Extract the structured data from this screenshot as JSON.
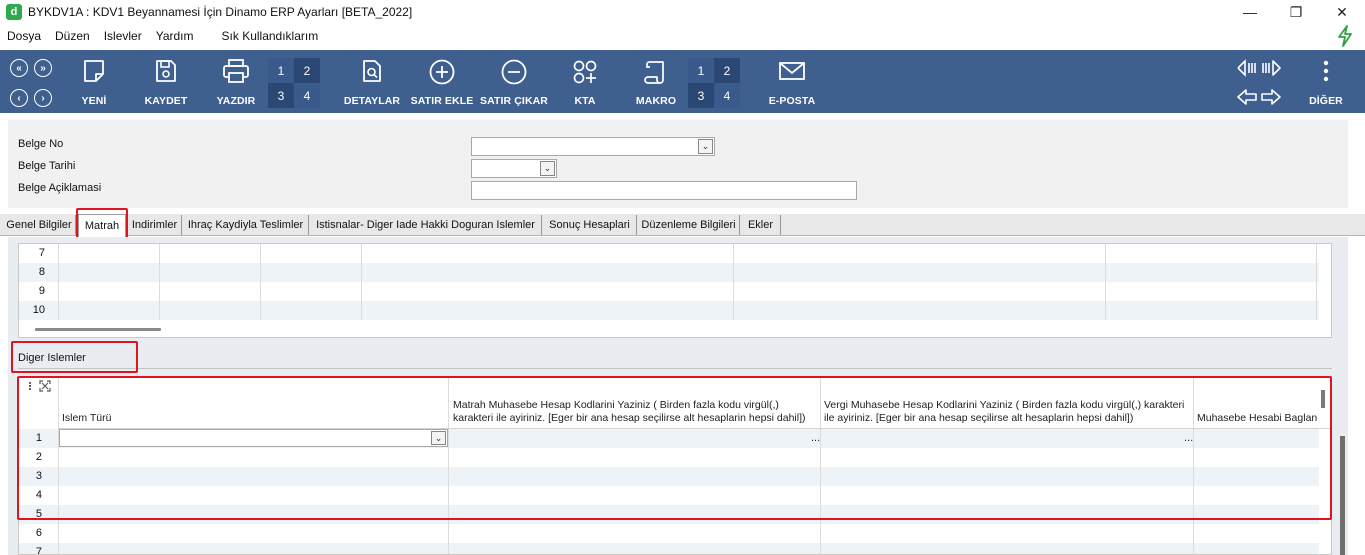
{
  "window": {
    "title": "BYKDV1A : KDV1 Beyannamesi İçin Dinamo ERP Ayarları [BETA_2022]",
    "app_icon_letter": "d",
    "minimize": "—",
    "restore": "❐",
    "close": "✕"
  },
  "menu": {
    "items": [
      "Dosya",
      "Düzen",
      "Islevler",
      "Yardım"
    ],
    "favorites": "Sık Kullandıklarım"
  },
  "toolbar": {
    "new_label": "YENİ",
    "save_label": "KAYDET",
    "print_label": "YAZDIR",
    "print_numbers": [
      "1",
      "2",
      "3",
      "4"
    ],
    "details_label": "DETAYLAR",
    "add_row_label": "SATIR EKLE",
    "remove_row_label": "SATIR ÇIKAR",
    "kta_label": "KTA",
    "macro_label": "MAKRO",
    "macro_numbers": [
      "1",
      "2",
      "3",
      "4"
    ],
    "email_label": "E-POSTA",
    "more_label": "DİĞER",
    "nav_first": "«",
    "nav_last": "»",
    "nav_prev": "‹",
    "nav_next": "›",
    "brand_color": "#3f5f8f"
  },
  "form": {
    "doc_no_label": "Belge No",
    "doc_date_label": "Belge Tarihi",
    "doc_desc_label": "Belge Açiklamasi",
    "doc_no_value": "",
    "doc_date_value": "",
    "doc_desc_value": ""
  },
  "tabs": [
    "Genel Bilgiler",
    "Matrah",
    "Indirimler",
    "Ihraç Kaydiyla Teslimler",
    "Istisnalar- Diger Iade Hakki Doguran Islemler",
    "Sonuç Hesaplari",
    "Düzenleme Bilgileri",
    "Ekler"
  ],
  "active_tab": "Matrah",
  "upper_grid": {
    "row_numbers": [
      "7",
      "8",
      "9",
      "10"
    ]
  },
  "lower_section": {
    "title": "Diger Islemler",
    "columns": [
      "Islem Türü",
      "Matrah Muhasebe Hesap Kodlarini Yaziniz ( Birden fazla kodu virgül(,) karakteri ile ayiriniz. [Eger bir ana hesap seçilirse alt hesaplarin hepsi dahil])",
      "Vergi Muhasebe Hesap Kodlarini Yaziniz ( Birden fazla kodu virgül(,) karakteri ile ayiriniz. [Eger bir ana hesap seçilirse alt hesaplarin hepsi dahil])",
      "Muhasebe Hesabi Baglan"
    ],
    "row_numbers": [
      "1",
      "2",
      "3",
      "4",
      "5",
      "6",
      "7"
    ],
    "ellipsis": "..."
  }
}
